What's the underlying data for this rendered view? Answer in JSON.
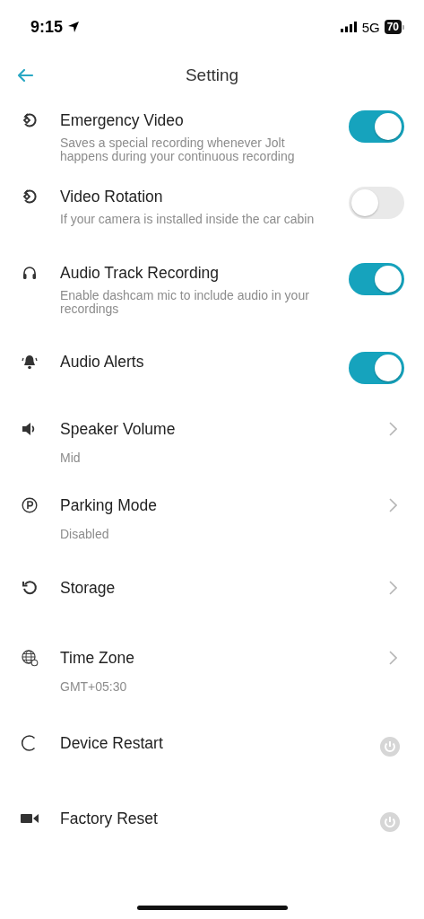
{
  "status_bar": {
    "time": "9:15",
    "network": "5G",
    "battery": "70"
  },
  "header": {
    "title": "Setting"
  },
  "settings": [
    {
      "kind": "toggle",
      "title": "Emergency Video",
      "description": "Saves a special recording whenever Jolt happens during your continuous recording",
      "on": true
    },
    {
      "kind": "toggle",
      "title": "Video Rotation",
      "description": "If your camera is installed inside the car cabin",
      "on": false
    },
    {
      "kind": "toggle",
      "title": "Audio Track Recording",
      "description": "Enable dashcam mic to include audio in your recordings",
      "on": true
    },
    {
      "kind": "toggle",
      "title": "Audio Alerts",
      "on": true
    },
    {
      "kind": "link",
      "title": "Speaker Volume",
      "value": "Mid"
    },
    {
      "kind": "link",
      "title": "Parking Mode",
      "value": "Disabled"
    },
    {
      "kind": "link",
      "title": "Storage"
    },
    {
      "kind": "link",
      "title": "Time Zone",
      "value": "GMT+05:30"
    },
    {
      "kind": "action",
      "title": "Device Restart"
    },
    {
      "kind": "action",
      "title": "Factory Reset"
    }
  ]
}
